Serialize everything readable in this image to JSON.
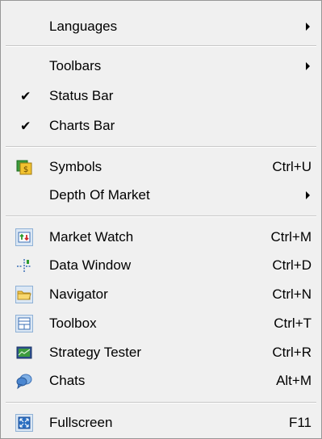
{
  "menu": {
    "languages": {
      "label": "Languages"
    },
    "toolbars": {
      "label": "Toolbars"
    },
    "status_bar": {
      "label": "Status Bar",
      "checked": true
    },
    "charts_bar": {
      "label": "Charts Bar",
      "checked": true
    },
    "symbols": {
      "label": "Symbols",
      "shortcut": "Ctrl+U",
      "icon": "symbols-icon"
    },
    "depth_of_market": {
      "label": "Depth Of Market"
    },
    "market_watch": {
      "label": "Market Watch",
      "shortcut": "Ctrl+M",
      "icon": "market-watch-icon"
    },
    "data_window": {
      "label": "Data Window",
      "shortcut": "Ctrl+D",
      "icon": "data-window-icon"
    },
    "navigator": {
      "label": "Navigator",
      "shortcut": "Ctrl+N",
      "icon": "folder-icon"
    },
    "toolbox": {
      "label": "Toolbox",
      "shortcut": "Ctrl+T",
      "icon": "toolbox-icon"
    },
    "strategy_tester": {
      "label": "Strategy Tester",
      "shortcut": "Ctrl+R",
      "icon": "strategy-tester-icon"
    },
    "chats": {
      "label": "Chats",
      "shortcut": "Alt+M",
      "icon": "chats-icon"
    },
    "fullscreen": {
      "label": "Fullscreen",
      "shortcut": "F11",
      "icon": "fullscreen-icon"
    },
    "check_glyph": "✔"
  }
}
